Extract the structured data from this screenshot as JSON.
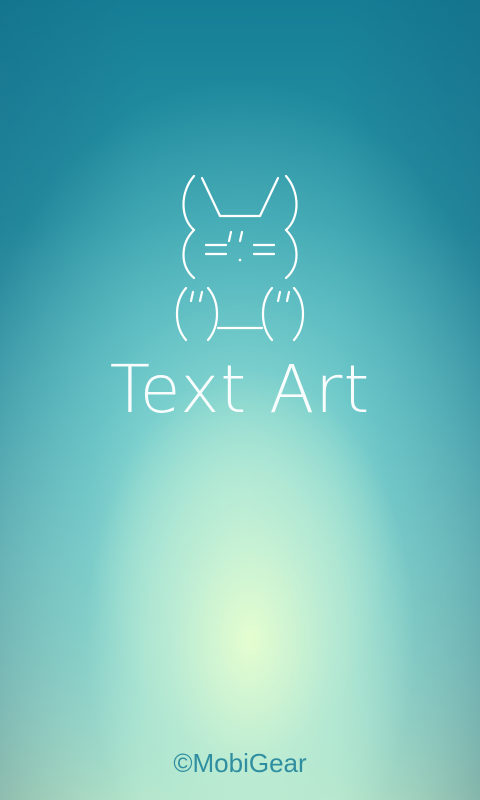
{
  "splash": {
    "title": "Text Art",
    "copyright": "©MobiGear"
  },
  "icons": {
    "mascot": "text-art-bunny-icon"
  },
  "colors": {
    "title": "#ffffff",
    "copyright": "#2f8ea0",
    "background_top": "#157e96",
    "background_bottom": "#cfeec8"
  }
}
